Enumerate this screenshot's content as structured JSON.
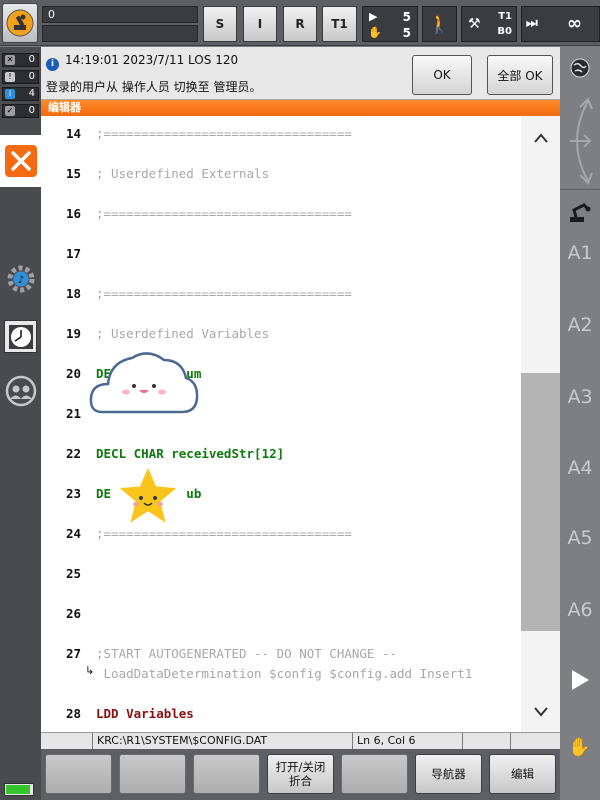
{
  "topbar": {
    "program_counter": "0",
    "mode_buttons": [
      "S",
      "I",
      "R",
      "T1"
    ],
    "run_counters": [
      "5",
      "5"
    ],
    "tool_info": [
      "T1",
      "B0"
    ],
    "override": "∞"
  },
  "message": {
    "timestamp": "14:19:01 2023/7/11 LOS 120",
    "text": "登录的用户从 操作人员 切换至 管理员。",
    "ok_label": "OK",
    "all_ok_label": "全部 OK"
  },
  "message_counters": [
    {
      "icon": "x",
      "value": "0",
      "color": "#9d9d9d"
    },
    {
      "icon": "!",
      "value": "0",
      "color": "#c9c9c9"
    },
    {
      "icon": "i",
      "value": "4",
      "color": "#2f8fd8"
    },
    {
      "icon": "c",
      "value": "0",
      "color": "#9d9d9d"
    }
  ],
  "editor": {
    "title": "编辑器",
    "lines": [
      {
        "num": "14",
        "text": ";=================================",
        "style": "comment"
      },
      {
        "num": "15",
        "text": "; Userdefined Externals",
        "style": "comment"
      },
      {
        "num": "16",
        "text": ";=================================",
        "style": "comment"
      },
      {
        "num": "17",
        "text": "",
        "style": "comment"
      },
      {
        "num": "18",
        "text": ";=================================",
        "style": "comment"
      },
      {
        "num": "19",
        "text": "; Userdefined Variables",
        "style": "comment"
      },
      {
        "num": "20",
        "text": "DE          um",
        "style": "decl"
      },
      {
        "num": "21",
        "text": "",
        "style": "decl"
      },
      {
        "num": "22",
        "text": "DECL CHAR receivedStr[12]",
        "style": "decl"
      },
      {
        "num": "23",
        "text": "DE          ub",
        "style": "decl"
      },
      {
        "num": "24",
        "text": ";=================================",
        "style": "comment"
      },
      {
        "num": "25",
        "text": "",
        "style": "comment"
      },
      {
        "num": "26",
        "text": "",
        "style": "comment"
      },
      {
        "num": "27",
        "text": ";START AUTOGENERATED -- DO NOT CHANGE --",
        "style": "comment"
      },
      {
        "num": "",
        "text": " LoadDataDetermination $config $config.add Insert1",
        "style": "comment"
      },
      {
        "num": "28",
        "text": "LDD Variables",
        "style": "ldd"
      }
    ]
  },
  "status": {
    "path": "KRC:\\R1\\SYSTEM\\$CONFIG.DAT",
    "cursor": "Ln 6, Col 6"
  },
  "softkeys": [
    "",
    "",
    "",
    "打开/关闭\n折合",
    "",
    "导航器",
    "编辑"
  ],
  "axes": [
    "A1",
    "A2",
    "A3",
    "A4",
    "A5",
    "A6"
  ],
  "colors": {
    "accent_orange": "#f36a0f",
    "comment_gray": "#a8a8a8",
    "decl_green": "#0d7a0d",
    "ldd_red": "#8a1010"
  }
}
